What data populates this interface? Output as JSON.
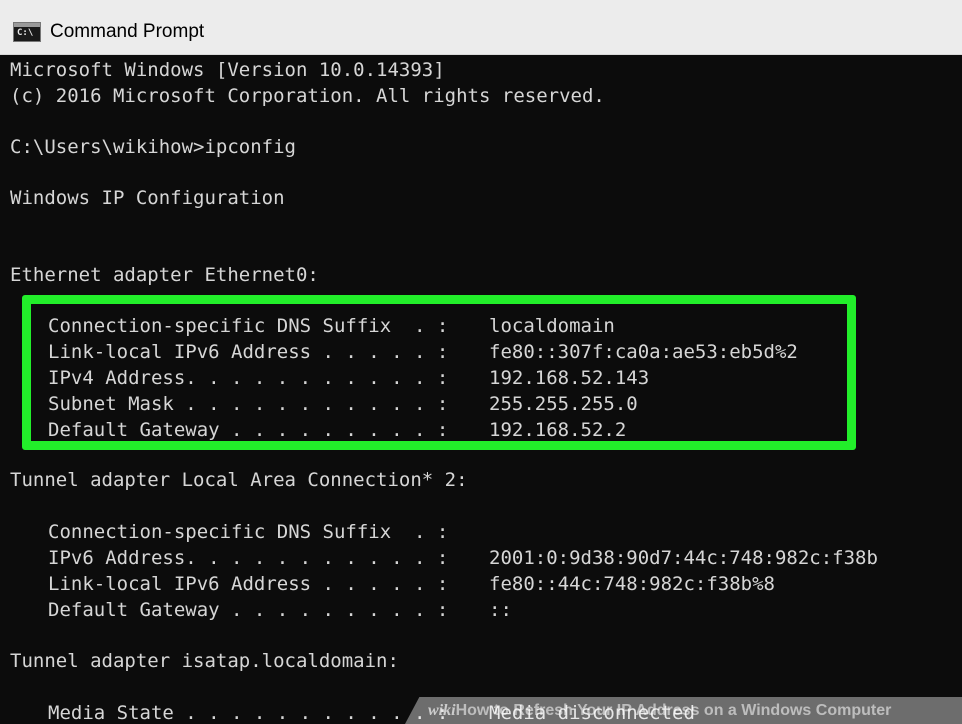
{
  "window": {
    "title": "Command Prompt",
    "icon": "cmd-console-icon",
    "icon_text": "C:\\",
    "highlight_color": "#22ee2a"
  },
  "console": {
    "version_line": "Microsoft Windows [Version 10.0.14393]",
    "copyright_line": "(c) 2016 Microsoft Corporation. All rights reserved.",
    "prompt_line": "C:\\Users\\wikihow>ipconfig",
    "config_heading": "Windows IP Configuration",
    "adapters": [
      {
        "header": "Ethernet adapter Ethernet0:",
        "entries": [
          {
            "label": "Connection-specific DNS Suffix  . :",
            "value": "localdomain"
          },
          {
            "label": "Link-local IPv6 Address . . . . . :",
            "value": "fe80::307f:ca0a:ae53:eb5d%2"
          },
          {
            "label": "IPv4 Address. . . . . . . . . . . :",
            "value": "192.168.52.143"
          },
          {
            "label": "Subnet Mask . . . . . . . . . . . :",
            "value": "255.255.255.0"
          },
          {
            "label": "Default Gateway . . . . . . . . . :",
            "value": "192.168.52.2"
          }
        ]
      },
      {
        "header": "Tunnel adapter Local Area Connection* 2:",
        "entries": [
          {
            "label": "Connection-specific DNS Suffix  . :",
            "value": ""
          },
          {
            "label": "IPv6 Address. . . . . . . . . . . :",
            "value": "2001:0:9d38:90d7:44c:748:982c:f38b"
          },
          {
            "label": "Link-local IPv6 Address . . . . . :",
            "value": "fe80::44c:748:982c:f38b%8"
          },
          {
            "label": "Default Gateway . . . . . . . . . :",
            "value": "::"
          }
        ]
      },
      {
        "header": "Tunnel adapter isatap.localdomain:",
        "entries": [
          {
            "label": "Media State . . . . . . . . . . . :",
            "value": "Media disconnected"
          }
        ]
      }
    ]
  },
  "watermark": {
    "logo": "wiki",
    "text": "How to Refresh Your IP Address on a Windows Computer"
  }
}
